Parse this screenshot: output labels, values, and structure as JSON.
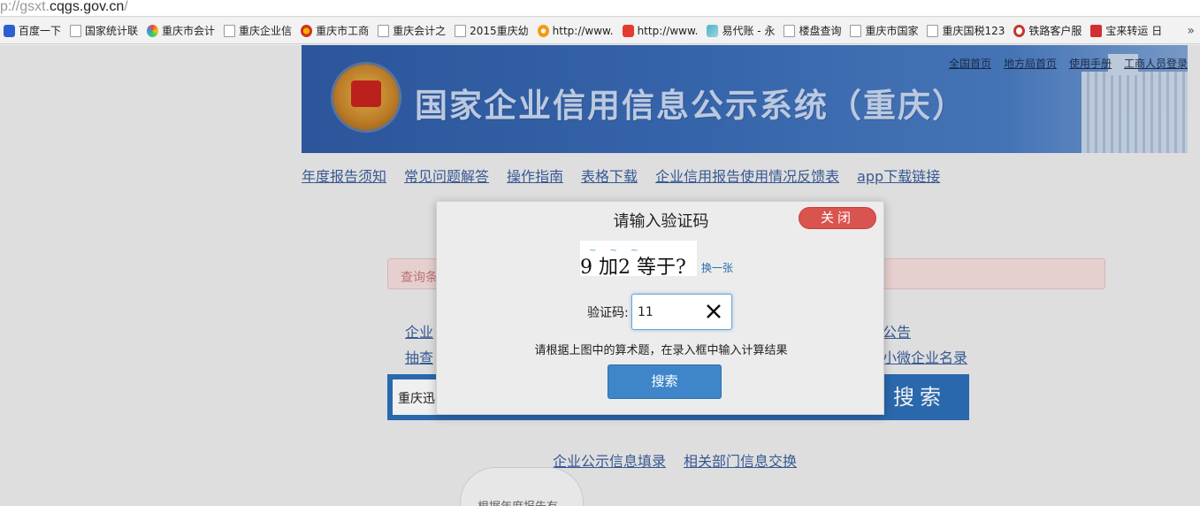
{
  "browser": {
    "url_prefix": "p://gsxt.",
    "url_domain": "cqgs.gov.cn",
    "url_suffix": "/",
    "bookmarks": [
      {
        "label": "百度一下",
        "icon": "baidu-icon"
      },
      {
        "label": "国家统计联",
        "icon": "page-icon"
      },
      {
        "label": "重庆市会计",
        "icon": "spinner-icon"
      },
      {
        "label": "重庆企业信",
        "icon": "page-icon"
      },
      {
        "label": "重庆市工商",
        "icon": "emblem-icon"
      },
      {
        "label": "重庆会计之",
        "icon": "page-icon"
      },
      {
        "label": "2015重庆幼",
        "icon": "page-icon"
      },
      {
        "label": "http://www.",
        "icon": "weibo-icon"
      },
      {
        "label": "http://www.",
        "icon": "s-icon"
      },
      {
        "label": "易代账 - 永",
        "icon": "leaf-icon"
      },
      {
        "label": "楼盘查询",
        "icon": "page-icon"
      },
      {
        "label": "重庆市国家",
        "icon": "page-icon"
      },
      {
        "label": "重庆国税123",
        "icon": "page-icon"
      },
      {
        "label": "铁路客户服",
        "icon": "rail-icon"
      },
      {
        "label": "宝来转运 日",
        "icon": "bao-icon"
      }
    ],
    "more": "»"
  },
  "header": {
    "title": "国家企业信用信息公示系统（重庆）",
    "top_links": [
      "全国首页",
      "地方局首页",
      "使用手册",
      "工商人员登录"
    ]
  },
  "nav": [
    "年度报告须知",
    "常见问题解答",
    "操作指南",
    "表格下载",
    "企业信用报告使用情况反馈表",
    "app下载链接"
  ],
  "query_bar": "查询条",
  "left_links": [
    "企业",
    "抽查"
  ],
  "right_links": [
    "公告",
    "小微企业名录"
  ],
  "search": {
    "value": "重庆迅",
    "button": "搜索"
  },
  "bottom_links": [
    "企业公示信息填录",
    "相关部门信息交换"
  ],
  "cloud_text": "根据年度报告有",
  "modal": {
    "title": "请输入验证码",
    "close": "关闭",
    "captcha_text": "9  加2 等于?",
    "refresh": "换一张",
    "code_label": "验证码:",
    "code_value": "11",
    "hint": "请根据上图中的算术题，在录入框中输入计算结果",
    "submit": "搜索"
  },
  "colors": {
    "banner": "#3a6bb5",
    "link": "#3b5f9c",
    "close": "#d9534f",
    "submit": "#3e86c9",
    "search_panel": "#2d6fb8"
  }
}
